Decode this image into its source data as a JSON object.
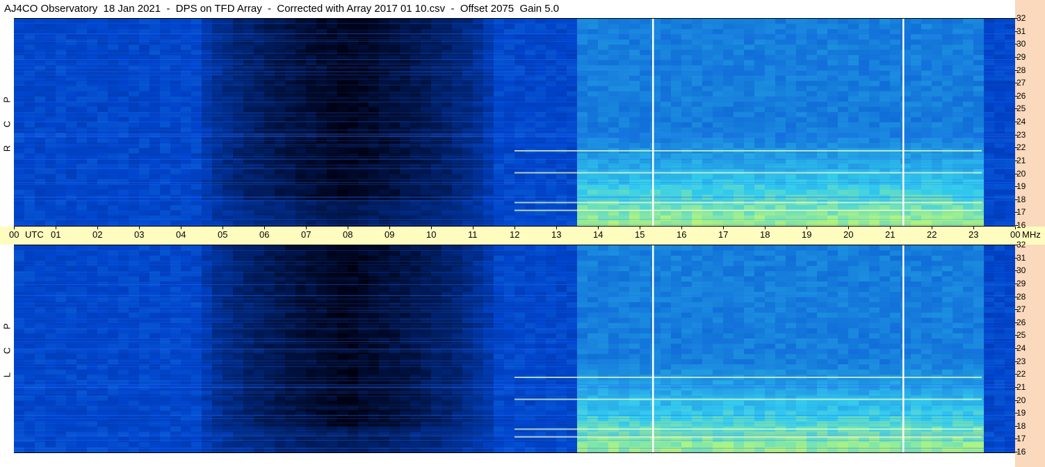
{
  "header": {
    "title": "AJ4CO Observatory  18 Jan 2021  -  DPS on TFD Array  -  Corrected with Array 2017 01 10.csv  -  Offset 2075  Gain 5.0"
  },
  "colors": {
    "background_strip": "#fad9bd",
    "time_axis": "#fffcc0",
    "low_intensity": "#000010",
    "mid_intensity": "#0044cc",
    "high_intensity": "#33ccee",
    "peak_intensity": "#ccff66"
  },
  "chart_data": [
    {
      "type": "heatmap",
      "panel": "RCP",
      "polarization_label": [
        "R",
        "C",
        "P"
      ],
      "x_axis": {
        "unit_label": "UTC",
        "ticks": [
          "00",
          "01",
          "02",
          "03",
          "04",
          "05",
          "06",
          "07",
          "08",
          "09",
          "10",
          "11",
          "12",
          "13",
          "14",
          "15",
          "16",
          "17",
          "18",
          "19",
          "20",
          "21",
          "22",
          "23",
          "00"
        ],
        "range_hours": [
          0,
          24
        ]
      },
      "y_axis": {
        "unit_label": "MHz",
        "ticks": [
          16,
          17,
          18,
          19,
          20,
          21,
          22,
          23,
          24,
          25,
          26,
          27,
          28,
          29,
          30,
          31,
          32
        ],
        "range_mhz": [
          16,
          32
        ]
      },
      "features": {
        "quiet_night_hours": [
          4.5,
          11.5
        ],
        "bright_day_hours": [
          13.5,
          23.2
        ],
        "vertical_gap_lines_hours": [
          15.3,
          21.3
        ],
        "strong_rfi_bands_mhz": [
          17.2,
          17.8,
          20.1,
          21.8
        ]
      }
    },
    {
      "type": "heatmap",
      "panel": "LCP",
      "polarization_label": [
        "L",
        "C",
        "P"
      ],
      "x_axis": {
        "unit_label": "UTC",
        "ticks": [
          "00",
          "01",
          "02",
          "03",
          "04",
          "05",
          "06",
          "07",
          "08",
          "09",
          "10",
          "11",
          "12",
          "13",
          "14",
          "15",
          "16",
          "17",
          "18",
          "19",
          "20",
          "21",
          "22",
          "23",
          "00"
        ],
        "range_hours": [
          0,
          24
        ]
      },
      "y_axis": {
        "unit_label": "MHz",
        "ticks": [
          16,
          17,
          18,
          19,
          20,
          21,
          22,
          23,
          24,
          25,
          26,
          27,
          28,
          29,
          30,
          31,
          32
        ],
        "range_mhz": [
          16,
          32
        ]
      },
      "features": {
        "quiet_night_hours": [
          4.5,
          11.5
        ],
        "bright_day_hours": [
          13.5,
          23.2
        ],
        "vertical_gap_lines_hours": [
          15.3,
          21.3
        ],
        "strong_rfi_bands_mhz": [
          17.2,
          17.8,
          20.1,
          21.8
        ]
      }
    }
  ]
}
